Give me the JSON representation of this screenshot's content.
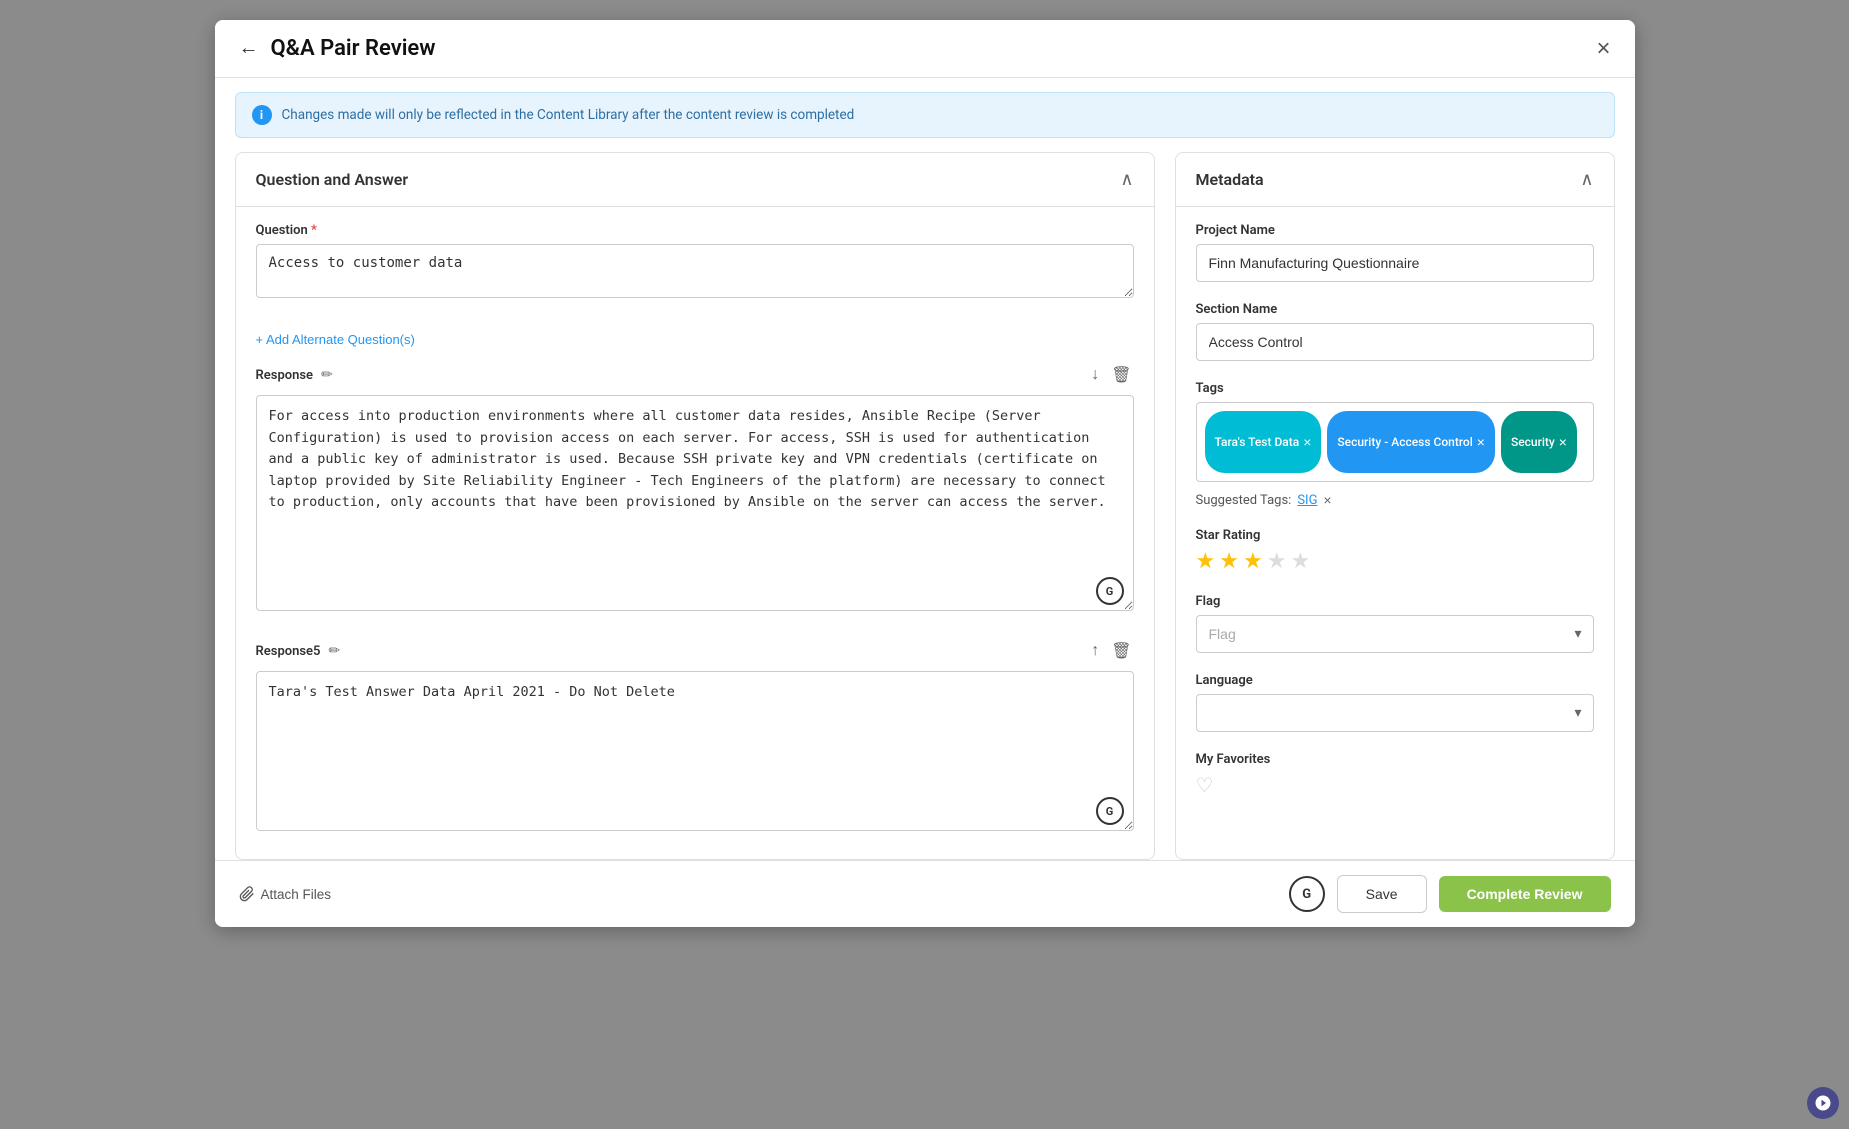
{
  "modal": {
    "title": "Q&A Pair Review",
    "close_label": "×",
    "back_label": "←"
  },
  "banner": {
    "text": "Changes made will only be reflected in the Content Library after the content review is completed"
  },
  "left_panel": {
    "title": "Question and Answer",
    "question_label": "Question",
    "question_value": "Access to customer data",
    "add_alternate_label": "+ Add Alternate Question(s)",
    "response_label": "Response",
    "response_value": "For access into production environments where all customer data resides, Ansible Recipe (Server Configuration) is used to provision access on each server. For access, SSH is used for authentication and a public key of administrator is used. Because SSH private key and VPN credentials (certificate on laptop provided by Site Reliability Engineer - Tech Engineers of the platform) are necessary to connect to production, only accounts that have been provisioned by Ansible on the server can access the server.",
    "response5_label": "Response5",
    "response5_value": "Tara's Test Answer Data April 2021 - Do Not Delete"
  },
  "right_panel": {
    "title": "Metadata",
    "project_name_label": "Project Name",
    "project_name_value": "Finn Manufacturing Questionnaire",
    "section_name_label": "Section Name",
    "section_name_value": "Access Control",
    "tags_label": "Tags",
    "tags": [
      {
        "label": "Tara's Test Data",
        "color": "cyan"
      },
      {
        "label": "Security - Access Control",
        "color": "blue"
      },
      {
        "label": "Security",
        "color": "teal"
      }
    ],
    "suggested_tags_label": "Suggested Tags:",
    "suggested_tag": "SIG",
    "star_rating_label": "Star Rating",
    "stars_filled": 3,
    "stars_total": 5,
    "flag_label": "Flag",
    "flag_placeholder": "Flag",
    "language_label": "Language",
    "language_placeholder": "",
    "favorites_label": "My Favorites"
  },
  "footer": {
    "attach_label": "Attach Files",
    "save_label": "Save",
    "complete_label": "Complete Review"
  }
}
